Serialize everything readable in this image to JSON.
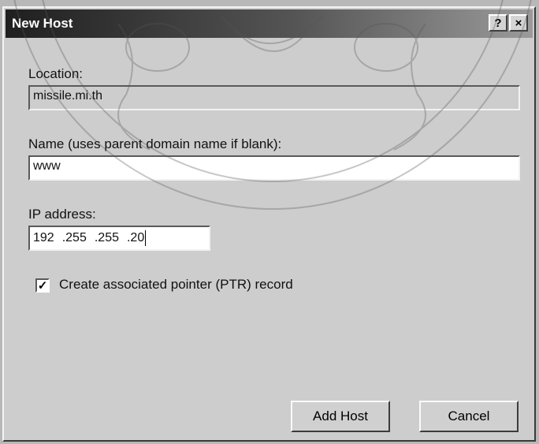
{
  "dialog": {
    "title": "New Host",
    "help_label": "?",
    "close_label": "×"
  },
  "location": {
    "label": "Location:",
    "value": "missile.mi.th"
  },
  "name": {
    "label": "Name (uses parent domain name if blank):",
    "value": "www"
  },
  "ip": {
    "label": "IP address:",
    "octets": [
      "192",
      ".255",
      ".255",
      ".20"
    ]
  },
  "ptr": {
    "label": "Create associated pointer (PTR) record",
    "checked": true,
    "check_glyph": "✓"
  },
  "buttons": {
    "add_host": "Add Host",
    "cancel": "Cancel"
  },
  "icons": {
    "help": "help-icon",
    "close": "close-icon",
    "check": "check-icon"
  }
}
